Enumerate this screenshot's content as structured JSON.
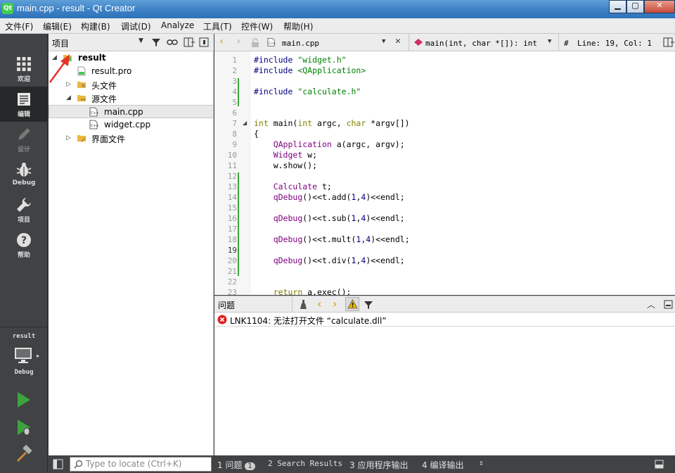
{
  "window": {
    "title": "main.cpp - result - Qt Creator",
    "logo_text": "Qt"
  },
  "menu": [
    "文件(F)",
    "编辑(E)",
    "构建(B)",
    "调试(D)",
    "Analyze",
    "工具(T)",
    "控件(W)",
    "帮助(H)"
  ],
  "modes": [
    {
      "label": "欢迎",
      "icon": "grid-icon"
    },
    {
      "label": "编辑",
      "icon": "edit-document-icon",
      "active": true
    },
    {
      "label": "设计",
      "icon": "pencil-icon",
      "dim": true
    },
    {
      "label": "Debug",
      "icon": "bug-icon"
    },
    {
      "label": "项目",
      "icon": "wrench-icon"
    },
    {
      "label": "帮助",
      "icon": "help-icon"
    }
  ],
  "kit": {
    "project": "result",
    "config": "Debug"
  },
  "project_panel": {
    "title": "项目",
    "tree": [
      {
        "label": "result",
        "icon": "qt-project-icon",
        "level": 0,
        "expanded": true,
        "bold": true
      },
      {
        "label": "result.pro",
        "icon": "pro-file-icon",
        "level": 1
      },
      {
        "label": "头文件",
        "icon": "header-folder-icon",
        "level": 1,
        "collapsed": true
      },
      {
        "label": "源文件",
        "icon": "source-folder-icon",
        "level": 1,
        "expanded": true
      },
      {
        "label": "main.cpp",
        "icon": "cpp-file-icon",
        "level": 2,
        "selected": true
      },
      {
        "label": "widget.cpp",
        "icon": "cpp-file-icon",
        "level": 2
      },
      {
        "label": "界面文件",
        "icon": "forms-folder-icon",
        "level": 1,
        "collapsed": true
      }
    ]
  },
  "editor_toolbar": {
    "file": "main.cpp",
    "function": "main(int, char *[]): int",
    "hash": "#",
    "position": "Line: 19, Col: 1"
  },
  "editor": {
    "current_line": 19,
    "lines": [
      {
        "n": "1",
        "html": "<span class=\"pp\">#include</span> <span class=\"str\">\"widget.h\"</span>"
      },
      {
        "n": "2",
        "html": "<span class=\"pp\">#include</span> <span class=\"str\">&lt;QApplication&gt;</span>"
      },
      {
        "n": "3",
        "html": ""
      },
      {
        "n": "4",
        "html": "<span class=\"pp\">#include</span> <span class=\"str\">\"calculate.h\"</span>"
      },
      {
        "n": "5",
        "html": ""
      },
      {
        "n": "6",
        "html": ""
      },
      {
        "n": "7",
        "html": "<span class=\"kw\">int</span> main(<span class=\"kw\">int</span> argc, <span class=\"kw\">char</span> *argv[])"
      },
      {
        "n": "8",
        "html": "{"
      },
      {
        "n": "9",
        "html": "    <span class=\"cls\">QApplication</span> a(argc, argv);"
      },
      {
        "n": "10",
        "html": "    <span class=\"cls\">Widget</span> w;"
      },
      {
        "n": "11",
        "html": "    w.show();"
      },
      {
        "n": "12",
        "html": ""
      },
      {
        "n": "13",
        "html": "    <span class=\"cls\">Calculate</span> t;"
      },
      {
        "n": "14",
        "html": "    <span class=\"cls\">qDebug</span>()&lt;&lt;t.add(<span class=\"num\">1</span>,<span class=\"num\">4</span>)&lt;&lt;endl;"
      },
      {
        "n": "15",
        "html": ""
      },
      {
        "n": "16",
        "html": "    <span class=\"cls\">qDebug</span>()&lt;&lt;t.sub(<span class=\"num\">1</span>,<span class=\"num\">4</span>)&lt;&lt;endl;"
      },
      {
        "n": "17",
        "html": ""
      },
      {
        "n": "18",
        "html": "    <span class=\"cls\">qDebug</span>()&lt;&lt;t.mult(<span class=\"num\">1</span>,<span class=\"num\">4</span>)&lt;&lt;endl;"
      },
      {
        "n": "19",
        "html": ""
      },
      {
        "n": "20",
        "html": "    <span class=\"cls\">qDebug</span>()&lt;&lt;t.div(<span class=\"num\">1</span>,<span class=\"num\">4</span>)&lt;&lt;endl;"
      },
      {
        "n": "21",
        "html": ""
      },
      {
        "n": "22",
        "html": ""
      },
      {
        "n": "23",
        "html": "    <span class=\"kw\">return</span> a.exec();"
      }
    ]
  },
  "issues": {
    "title": "问题",
    "items": [
      {
        "severity": "error",
        "text": "LNK1104: 无法打开文件 “calculate.dll”"
      }
    ]
  },
  "bottom": {
    "locate_placeholder": "Type to locate (Ctrl+K)",
    "tabs": [
      {
        "num": "1",
        "label": "问题",
        "badge": "1"
      },
      {
        "num": "2",
        "label": "Search Results"
      },
      {
        "num": "3",
        "label": "应用程序输出"
      },
      {
        "num": "4",
        "label": "编译输出"
      }
    ]
  },
  "colors": {
    "accent": "#3da33d",
    "error": "#e02020",
    "annotation_arrow": "#e8322a"
  }
}
